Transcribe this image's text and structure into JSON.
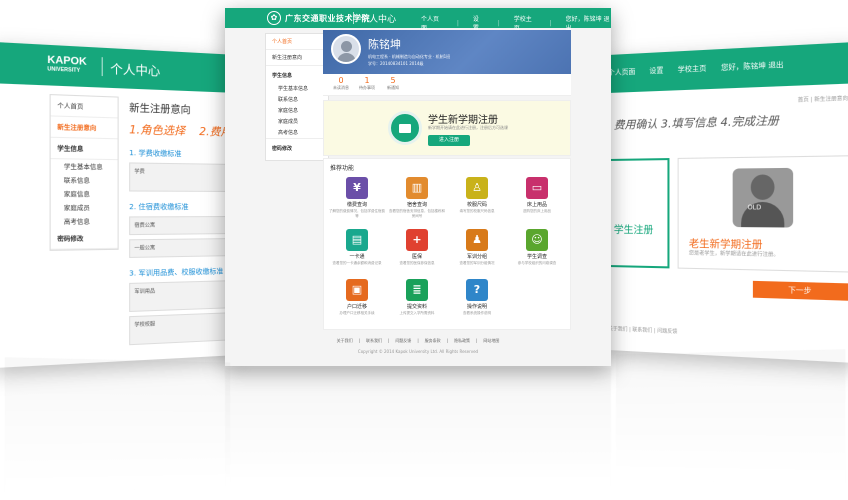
{
  "left_screen": {
    "brand": "KAPOK",
    "brand_sub": "UNIVERSITY",
    "title": "个人中心",
    "nav": [
      "个人首页",
      "新生注册意向",
      "学生信息",
      "学生基本信息",
      "联系信息",
      "家庭信息",
      "家庭成员",
      "高考信息",
      "密码修改"
    ],
    "heading": "新生注册意向",
    "step1": "1.角色选择",
    "step2": "2.费用",
    "sec1": "1. 学费收缴标准",
    "sec2": "2. 住宿费收缴标准",
    "sec3": "3. 军训用品费、校服收缴标准",
    "row_labels": [
      "学费",
      "宿费公寓",
      "一般公寓",
      "军训用品",
      "学校校服"
    ]
  },
  "right_screen": {
    "nav": [
      "个人页面",
      "设置",
      "学校主页",
      "您好，陈铭坤  退出"
    ],
    "breadcrumb": "首页 | 新生注册意向",
    "steps": "费用确认   3.填写信息   4.完成注册",
    "card1_title": "学生注册",
    "card2_tag": "OLD",
    "card2_title": "老生新学期注册",
    "card2_desc": "您是老学生，新学期请在此进行注册。",
    "next_button": "下一步",
    "footer": "关于我们 | 联系我们 | 问题反馈"
  },
  "center": {
    "brand": "广东交通职业技术学院",
    "page_title": "个人中心",
    "topnav": [
      "个人页面",
      "设置",
      "学校主页",
      "您好，陈铭坤  退出"
    ],
    "sidenav": [
      "个人首页",
      "新生注册意向",
      "学生信息",
      "学生基本信息",
      "联系信息",
      "家庭信息",
      "家庭成员",
      "高考信息",
      "密码修改"
    ],
    "profile": {
      "name": "陈铭坤",
      "line1": "机电工程系 · 机械制造与自动化专业 · 机制1班",
      "line2": "学号：20140834101   2014级"
    },
    "stats": [
      {
        "n": "0",
        "l": "未读消息"
      },
      {
        "n": "1",
        "l": "待办事项"
      },
      {
        "n": "5",
        "l": "新通知"
      }
    ],
    "banner": {
      "title": "学生新学期注册",
      "desc": "新学期开始请在此进行注册，注册后方可选课",
      "button": "进入注册"
    },
    "features_title": "推荐功能",
    "features": [
      {
        "name": "缴费查询",
        "desc": "了解您的缴费情况，包括学费住宿费等",
        "color": "#6b4fa8",
        "icon": "piggy-bank"
      },
      {
        "name": "宿舍查询",
        "desc": "查看您的宿舍安排信息，包括楼栋和房间号",
        "color": "#e28b2e",
        "icon": "building"
      },
      {
        "name": "校服尺码",
        "desc": "填写您的校服尺码信息",
        "color": "#c9b21a",
        "icon": "uniform"
      },
      {
        "name": "床上用品",
        "desc": "选购您的床上用品",
        "color": "#c8306c",
        "icon": "bed"
      },
      {
        "name": "一卡通",
        "desc": "查看您的一卡通余额和消费记录",
        "color": "#1aa88e",
        "icon": "card"
      },
      {
        "name": "医保",
        "desc": "查看您的医保参保信息",
        "color": "#e04130",
        "icon": "medical-cross"
      },
      {
        "name": "军训分组",
        "desc": "查看您的军训分组情况",
        "color": "#d87a1a",
        "icon": "group"
      },
      {
        "name": "学生调查",
        "desc": "参与学校组织的问卷调查",
        "color": "#5aa62e",
        "icon": "smile"
      },
      {
        "name": "户口迁移",
        "desc": "办理户口迁移相关手续",
        "color": "#e56a1f",
        "icon": "id-card"
      },
      {
        "name": "提交资料",
        "desc": "上传提交入学所需资料",
        "color": "#1aa15a",
        "icon": "document"
      },
      {
        "name": "操作说明",
        "desc": "查看系统操作说明",
        "color": "#2f86c9",
        "icon": "question"
      }
    ],
    "footer_links": [
      "关于我们",
      "联系我们",
      "问题反馈",
      "服务条款",
      "隐私政策",
      "网站地图"
    ],
    "copyright": "Copyright © 2014 Kapok University Ltd. All Rights Reserved"
  }
}
